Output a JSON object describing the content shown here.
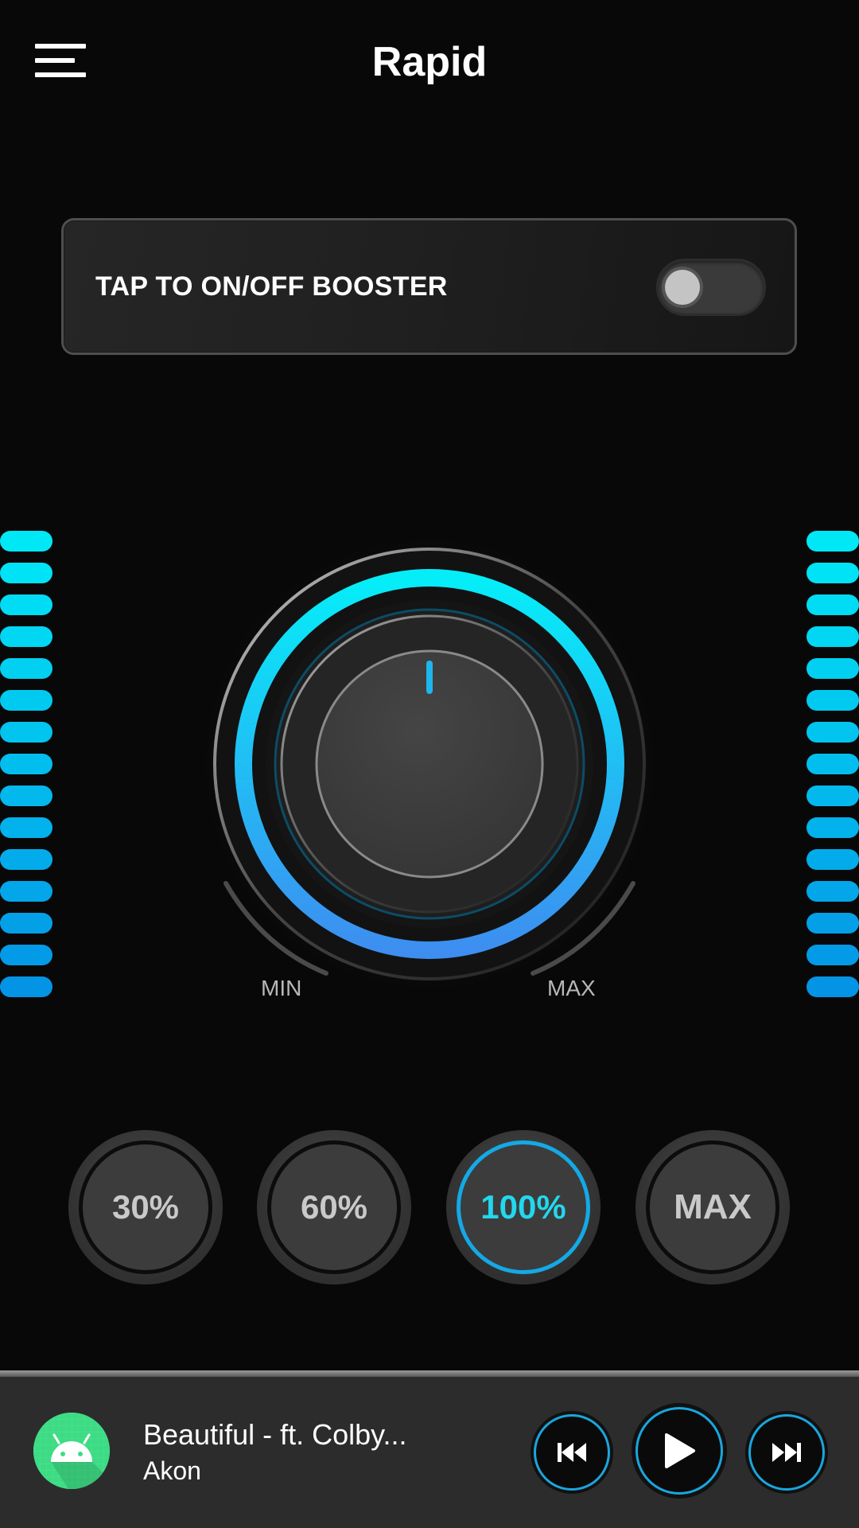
{
  "header": {
    "title": "Rapid",
    "menu_icon": "hamburger-menu-icon"
  },
  "booster": {
    "label": "TAP TO ON/OFF BOOSTER",
    "enabled": false
  },
  "knob": {
    "min_label": "MIN",
    "max_label": "MAX",
    "level_percent": 100,
    "colors": {
      "arc_start": "#05eef8",
      "arc_end": "#3d8ef0"
    }
  },
  "meters": {
    "segment_count": 15,
    "colors": {
      "top": "#00e8f6",
      "bottom": "#0394e6"
    }
  },
  "presets": [
    {
      "label": "30%",
      "active": false
    },
    {
      "label": "60%",
      "active": false
    },
    {
      "label": "100%",
      "active": true
    },
    {
      "label": "MAX",
      "active": false
    }
  ],
  "player": {
    "title": "Beautiful - ft. Colby...",
    "artist": "Akon",
    "album_icon": "android-icon",
    "controls": {
      "prev_icon": "skip-previous-icon",
      "play_icon": "play-icon",
      "next_icon": "skip-next-icon"
    }
  },
  "colors": {
    "accent": "#14a9e6",
    "accent_text": "#22d7ee",
    "background": "#080808"
  }
}
